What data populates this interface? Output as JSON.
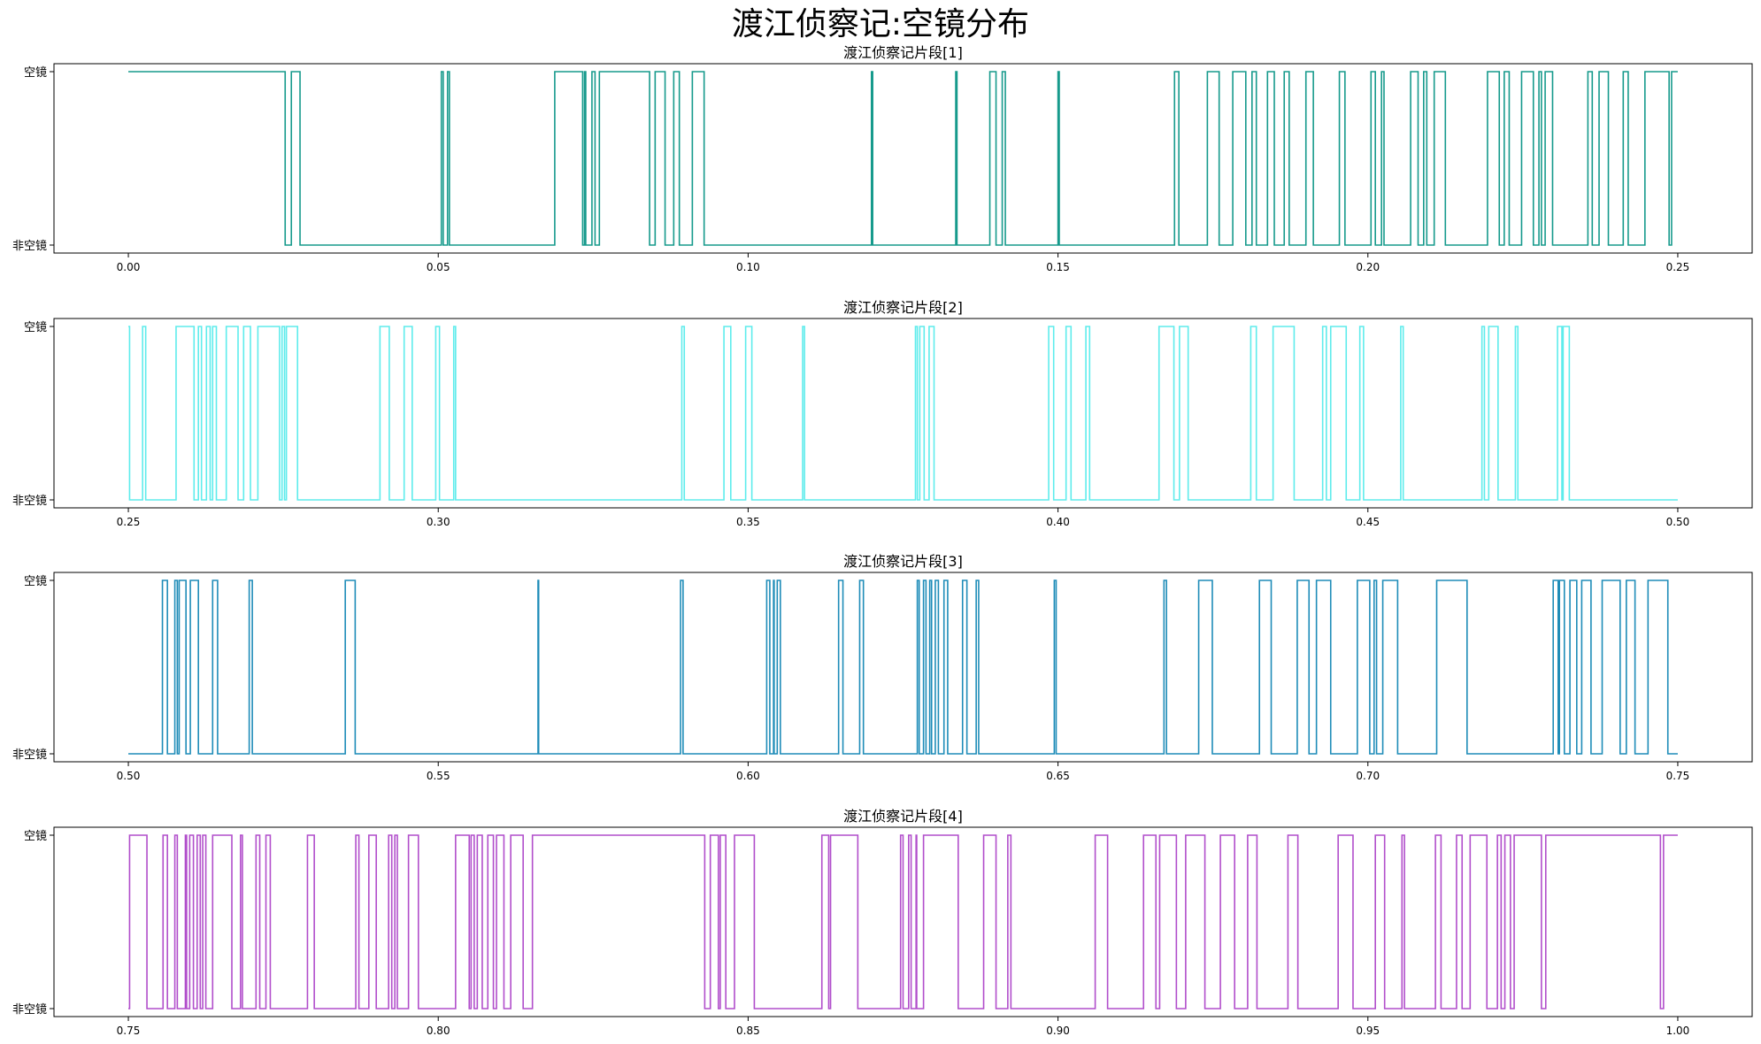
{
  "figure": {
    "title": "渡江侦察记:空镜分布"
  },
  "chart_data": [
    {
      "type": "line",
      "step": true,
      "title": "渡江侦察记片段[1]",
      "color": "#169a8c",
      "xlim": [
        -0.012,
        0.262
      ],
      "xticks": [
        "0.00",
        "0.05",
        "0.10",
        "0.15",
        "0.20",
        "0.25"
      ],
      "ylim": [
        0,
        1
      ],
      "yticklabels": [
        "非空镜",
        "空镜"
      ],
      "x_start": 0.0,
      "x_end": 0.25,
      "initial": 1,
      "toggles": [
        0.0253,
        0.0263,
        0.0277,
        0.0505,
        0.0508,
        0.0515,
        0.0518,
        0.0688,
        0.0733,
        0.0736,
        0.0738,
        0.0748,
        0.0753,
        0.076,
        0.0841,
        0.085,
        0.0866,
        0.088,
        0.0889,
        0.091,
        0.0929,
        0.1199,
        0.1201,
        0.1335,
        0.1337,
        0.139,
        0.14,
        0.141,
        0.1415,
        0.15,
        0.1502,
        0.1688,
        0.1695,
        0.1741,
        0.176,
        0.1782,
        0.1803,
        0.1813,
        0.182,
        0.1838,
        0.1849,
        0.1865,
        0.1873,
        0.19,
        0.1912,
        0.1954,
        0.1963,
        0.2005,
        0.2012,
        0.2022,
        0.2026,
        0.2069,
        0.2081,
        0.209,
        0.2095,
        0.2107,
        0.2125,
        0.2193,
        0.2212,
        0.222,
        0.2228,
        0.2248,
        0.2267,
        0.2276,
        0.228,
        0.2286,
        0.2298,
        0.2355,
        0.2362,
        0.2373,
        0.2388,
        0.2412,
        0.242,
        0.2447,
        0.2486,
        0.249
      ]
    },
    {
      "type": "line",
      "step": true,
      "title": "渡江侦察记片段[2]",
      "color": "#5eecec",
      "xlim": [
        0.238,
        0.512
      ],
      "xticks": [
        "0.25",
        "0.30",
        "0.35",
        "0.40",
        "0.45",
        "0.50"
      ],
      "ylim": [
        0,
        1
      ],
      "yticklabels": [
        "非空镜",
        "空镜"
      ],
      "x_start": 0.25,
      "x_end": 0.5,
      "initial": 1,
      "toggles": [
        0.2502,
        0.2523,
        0.2528,
        0.2577,
        0.2606,
        0.2613,
        0.2618,
        0.2626,
        0.2632,
        0.2636,
        0.2642,
        0.2658,
        0.2677,
        0.2686,
        0.2697,
        0.2709,
        0.2744,
        0.2748,
        0.2752,
        0.2755,
        0.2773,
        0.2906,
        0.2921,
        0.2945,
        0.2958,
        0.2996,
        0.3002,
        0.3025,
        0.3028,
        0.3393,
        0.3397,
        0.3461,
        0.3472,
        0.3496,
        0.3506,
        0.3588,
        0.3591,
        0.377,
        0.3773,
        0.3777,
        0.3784,
        0.3792,
        0.38,
        0.3985,
        0.3993,
        0.4013,
        0.4021,
        0.4045,
        0.4051,
        0.4163,
        0.4187,
        0.4196,
        0.421,
        0.4311,
        0.432,
        0.4347,
        0.4381,
        0.4427,
        0.4433,
        0.444,
        0.4465,
        0.4487,
        0.4493,
        0.4553,
        0.4557,
        0.4684,
        0.4688,
        0.4695,
        0.471,
        0.4738,
        0.4742,
        0.4806,
        0.4813,
        0.4815,
        0.4825
      ]
    },
    {
      "type": "line",
      "step": true,
      "title": "渡江侦察记片段[3]",
      "color": "#1e8cb8",
      "xlim": [
        0.488,
        0.762
      ],
      "xticks": [
        "0.50",
        "0.55",
        "0.60",
        "0.65",
        "0.70",
        "0.75"
      ],
      "ylim": [
        0,
        1
      ],
      "yticklabels": [
        "非空镜",
        "空镜"
      ],
      "x_start": 0.5,
      "x_end": 0.75,
      "initial": 0,
      "toggles": [
        0.5055,
        0.5063,
        0.5075,
        0.5079,
        0.5082,
        0.5093,
        0.51,
        0.5113,
        0.5136,
        0.5144,
        0.5195,
        0.52,
        0.535,
        0.5366,
        0.5661,
        0.5662,
        0.5891,
        0.5895,
        0.603,
        0.6035,
        0.6041,
        0.6042,
        0.6047,
        0.6052,
        0.6146,
        0.6153,
        0.618,
        0.6186,
        0.6273,
        0.6276,
        0.6283,
        0.6287,
        0.6293,
        0.6296,
        0.6302,
        0.6307,
        0.6316,
        0.6322,
        0.6346,
        0.6353,
        0.6368,
        0.6372,
        0.6494,
        0.6497,
        0.6671,
        0.6675,
        0.6727,
        0.6749,
        0.6825,
        0.6844,
        0.6886,
        0.6905,
        0.6917,
        0.694,
        0.6983,
        0.7003,
        0.701,
        0.7014,
        0.7024,
        0.7048,
        0.7111,
        0.716,
        0.7299,
        0.7307,
        0.7309,
        0.7317,
        0.7326,
        0.7337,
        0.7345,
        0.736,
        0.7378,
        0.7407,
        0.7417,
        0.7431,
        0.7452,
        0.7484
      ]
    },
    {
      "type": "line",
      "step": true,
      "title": "渡江侦察记片段[4]",
      "color": "#b14ecb",
      "xlim": [
        0.738,
        1.012
      ],
      "xticks": [
        "0.75",
        "0.80",
        "0.85",
        "0.90",
        "0.95",
        "1.00"
      ],
      "ylim": [
        0,
        1
      ],
      "yticklabels": [
        "非空镜",
        "空镜"
      ],
      "x_start": 0.75,
      "x_end": 1.0,
      "initial": 0,
      "toggles": [
        0.7502,
        0.753,
        0.7556,
        0.7563,
        0.7575,
        0.7579,
        0.7592,
        0.7594,
        0.7599,
        0.7605,
        0.7611,
        0.7616,
        0.762,
        0.7625,
        0.7636,
        0.7667,
        0.7681,
        0.7684,
        0.7706,
        0.7712,
        0.7722,
        0.7729,
        0.7789,
        0.78,
        0.7867,
        0.7872,
        0.7888,
        0.79,
        0.792,
        0.7925,
        0.793,
        0.7934,
        0.7952,
        0.7968,
        0.8028,
        0.805,
        0.8053,
        0.8058,
        0.8063,
        0.8071,
        0.808,
        0.8089,
        0.8094,
        0.8106,
        0.8117,
        0.8137,
        0.8152,
        0.843,
        0.8439,
        0.8452,
        0.8455,
        0.8464,
        0.8478,
        0.851,
        0.8619,
        0.863,
        0.8633,
        0.8677,
        0.8746,
        0.875,
        0.8759,
        0.8763,
        0.8771,
        0.8772,
        0.8783,
        0.8839,
        0.888,
        0.89,
        0.8919,
        0.8924,
        0.906,
        0.908,
        0.9138,
        0.9158,
        0.9164,
        0.9191,
        0.9206,
        0.9237,
        0.9262,
        0.9285,
        0.9306,
        0.9321,
        0.9371,
        0.9387,
        0.9452,
        0.9476,
        0.9512,
        0.9527,
        0.9555,
        0.9559,
        0.9609,
        0.9618,
        0.9643,
        0.9652,
        0.9665,
        0.9692,
        0.9709,
        0.9715,
        0.9721,
        0.973,
        0.9736,
        0.978,
        0.9787,
        0.9972,
        0.9977
      ]
    }
  ]
}
